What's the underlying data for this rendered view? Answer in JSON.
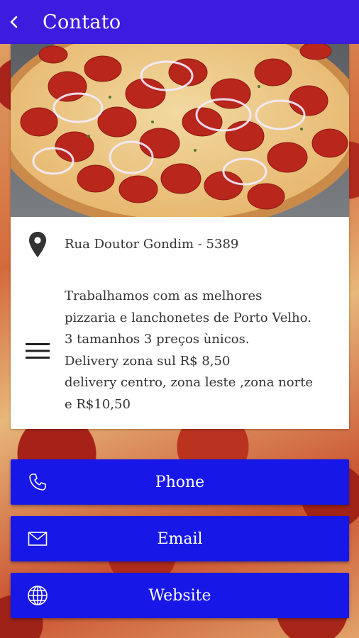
{
  "header": {
    "title": "Contato",
    "back_icon": "chevron-left-icon"
  },
  "colors": {
    "appbar": "#3d1ce0",
    "button": "#1717e8"
  },
  "contact_card": {
    "photo_alt": "pepperoni pizza photo",
    "address": {
      "icon": "location-pin-icon",
      "text": "Rua Doutor Gondim - 5389"
    },
    "description": {
      "icon": "menu-lines-icon",
      "lines": [
        "Trabalhamos com as melhores",
        "pizzaria e lanchonetes de Porto Velho.",
        "3 tamanhos 3 preços ùnicos.",
        "Delivery zona sul R$ 8,50",
        "delivery centro, zona leste ,zona norte",
        "e R$10,50"
      ]
    }
  },
  "actions": [
    {
      "label": "Phone",
      "icon": "phone-icon"
    },
    {
      "label": "Email",
      "icon": "envelope-icon"
    },
    {
      "label": "Website",
      "icon": "globe-icon"
    }
  ]
}
